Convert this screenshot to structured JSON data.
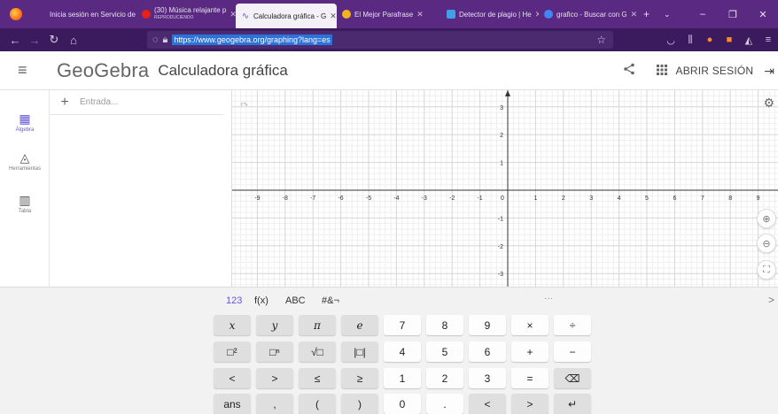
{
  "browser": {
    "tabs": [
      {
        "label": "Inicia sesión en Servicio de",
        "icon": "firefox-account-icon"
      },
      {
        "label": "(30) Música relajante p",
        "sublabel": "REPRODUCIENDO",
        "icon": "youtube-icon"
      },
      {
        "label": "Calculadora gráfica - G",
        "icon": "geogebra-icon",
        "active": true
      },
      {
        "label": "El Mejor Parafrase",
        "icon": "parafraseo-icon"
      },
      {
        "label": "Detector de plagio | He",
        "icon": "plagio-icon"
      },
      {
        "label": "grafico - Buscar con G",
        "icon": "google-icon"
      }
    ],
    "url": "https://www.geogebra.org/graphing?lang=es"
  },
  "app": {
    "logo": "GeoGebra",
    "title": "Calculadora gráfica",
    "signin": "ABRIR SESIÓN"
  },
  "sidebar": {
    "items": [
      {
        "label": "Álgebra",
        "icon": "calculator-icon",
        "active": true
      },
      {
        "label": "Herramientas",
        "icon": "tools-icon"
      },
      {
        "label": "Tabla",
        "icon": "table-icon"
      }
    ]
  },
  "algebra": {
    "placeholder": "Entrada..."
  },
  "graph": {
    "x_ticks": [
      "-9",
      "-8",
      "-7",
      "-6",
      "-5",
      "-4",
      "-3",
      "-2",
      "-1",
      "0",
      "1",
      "2",
      "3",
      "4",
      "5",
      "6",
      "7",
      "8",
      "9"
    ],
    "y_ticks_pos": [
      "3",
      "2",
      "1"
    ],
    "y_ticks_neg": [
      "-1",
      "-2",
      "-3"
    ]
  },
  "keyboard": {
    "tabs": [
      "123",
      "f(x)",
      "ABC",
      "#&¬"
    ],
    "more": "···",
    "close": ">",
    "rows": [
      [
        "x",
        "y",
        "π",
        "e",
        "7",
        "8",
        "9",
        "×",
        "÷"
      ],
      [
        "□²",
        "□ⁿ",
        "√□",
        "|□|",
        "4",
        "5",
        "6",
        "+",
        "−"
      ],
      [
        "<",
        ">",
        "≤",
        "≥",
        "1",
        "2",
        "3",
        "=",
        "⌫"
      ],
      [
        "ans",
        ",",
        "(",
        ")",
        "0",
        ".",
        "<",
        ">",
        "↵"
      ]
    ]
  }
}
